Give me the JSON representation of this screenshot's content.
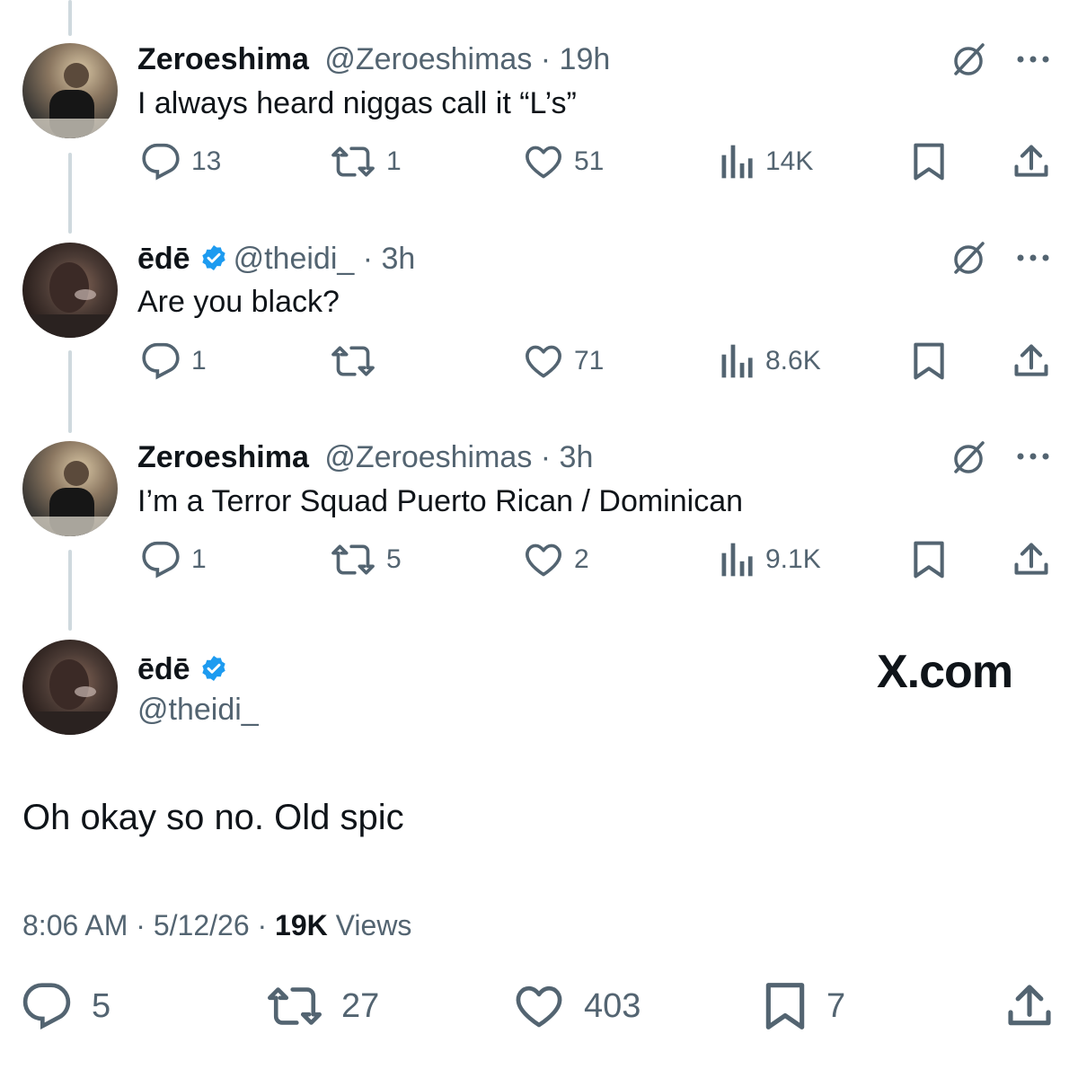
{
  "replies": [
    {
      "name": "Zeroeshima",
      "handle": "@Zeroeshimas · 19h",
      "verified": false,
      "text": "I always heard niggas call it “L’s”",
      "replies": "13",
      "reposts": "1",
      "likes": "51",
      "views": "14K"
    },
    {
      "name": "ēdē",
      "handle": "@theidi_ · 3h",
      "verified": true,
      "text": "Are you black?",
      "replies": "1",
      "reposts": "",
      "likes": "71",
      "views": "8.6K"
    },
    {
      "name": "Zeroeshima",
      "handle": "@Zeroeshimas · 3h",
      "verified": false,
      "text": "I’m a Terror Squad Puerto Rican / Dominican",
      "replies": "1",
      "reposts": "5",
      "likes": "2",
      "views": "9.1K"
    }
  ],
  "main": {
    "name": "ēdē",
    "handle": "@theidi_",
    "watermark": "X.com",
    "text": "Oh okay so no. Old spic",
    "time": "8:06 AM · 5/12/26 · ",
    "views_count": "19K",
    "views_label": " Views",
    "replies": "5",
    "reposts": "27",
    "likes": "403",
    "bookmarks": "7"
  },
  "colors": {
    "text": "#0f1419",
    "secondary": "#536471",
    "verified": "#1d9bf0",
    "thread_line": "#cfd9de"
  },
  "icons": [
    "reply-icon",
    "repost-icon",
    "like-icon",
    "views-icon",
    "bookmark-icon",
    "share-icon",
    "grok-icon",
    "more-icon",
    "verified-badge-icon"
  ]
}
